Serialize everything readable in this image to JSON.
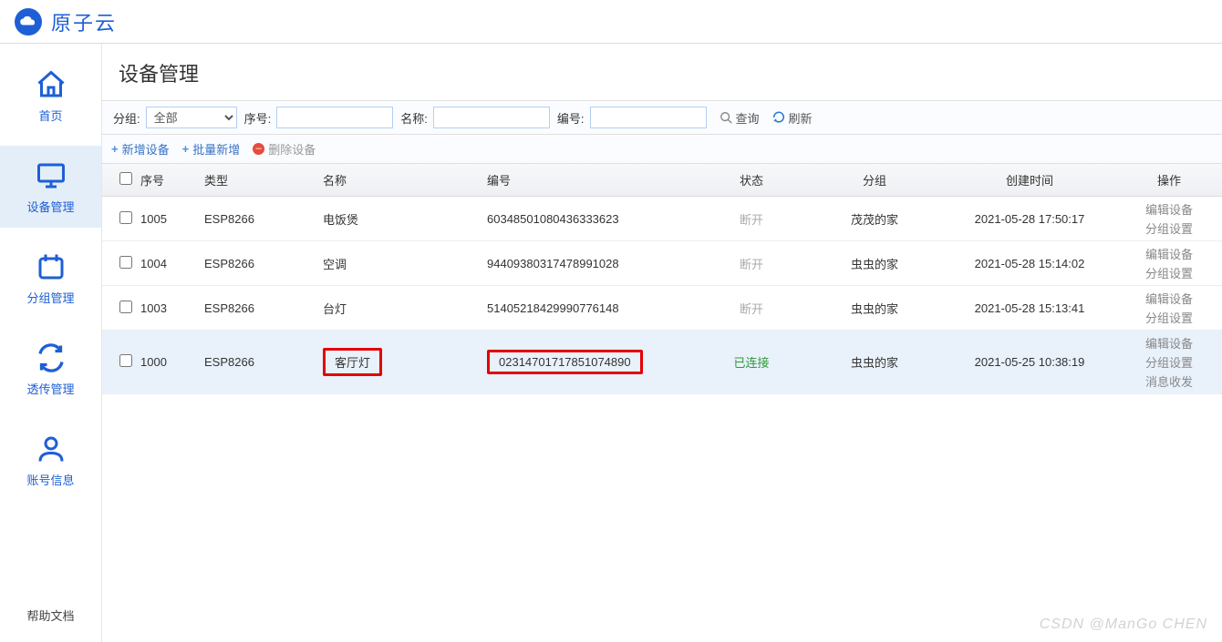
{
  "app": {
    "title": "原子云",
    "logo_text": "Cloud"
  },
  "sidebar": {
    "items": [
      {
        "label": "首页"
      },
      {
        "label": "设备管理"
      },
      {
        "label": "分组管理"
      },
      {
        "label": "透传管理"
      },
      {
        "label": "账号信息"
      }
    ],
    "help": "帮助文档"
  },
  "page": {
    "title": "设备管理"
  },
  "filters": {
    "group_label": "分组:",
    "group_value": "全部",
    "seq_label": "序号:",
    "name_label": "名称:",
    "code_label": "编号:",
    "query": "查询",
    "refresh": "刷新"
  },
  "actions": {
    "add": "新增设备",
    "batch": "批量新增",
    "delete": "删除设备"
  },
  "columns": {
    "seq": "序号",
    "type": "类型",
    "name": "名称",
    "code": "编号",
    "status": "状态",
    "group": "分组",
    "time": "创建时间",
    "ops": "操作"
  },
  "ops": {
    "edit": "编辑设备",
    "group": "分组设置",
    "msg": "消息收发"
  },
  "rows": [
    {
      "seq": "1005",
      "type": "ESP8266",
      "name": "电饭煲",
      "code": "60348501080436333623",
      "status": "断开",
      "connected": false,
      "group": "茂茂的家",
      "time": "2021-05-28 17:50:17",
      "highlight": false
    },
    {
      "seq": "1004",
      "type": "ESP8266",
      "name": "空调",
      "code": "94409380317478991028",
      "status": "断开",
      "connected": false,
      "group": "虫虫的家",
      "time": "2021-05-28 15:14:02",
      "highlight": false
    },
    {
      "seq": "1003",
      "type": "ESP8266",
      "name": "台灯",
      "code": "51405218429990776148",
      "status": "断开",
      "connected": false,
      "group": "虫虫的家",
      "time": "2021-05-28 15:13:41",
      "highlight": false
    },
    {
      "seq": "1000",
      "type": "ESP8266",
      "name": "客厅灯",
      "code": "02314701717851074890",
      "status": "已连接",
      "connected": true,
      "group": "虫虫的家",
      "time": "2021-05-25 10:38:19",
      "highlight": true
    }
  ],
  "watermark": "CSDN @ManGo CHEN"
}
